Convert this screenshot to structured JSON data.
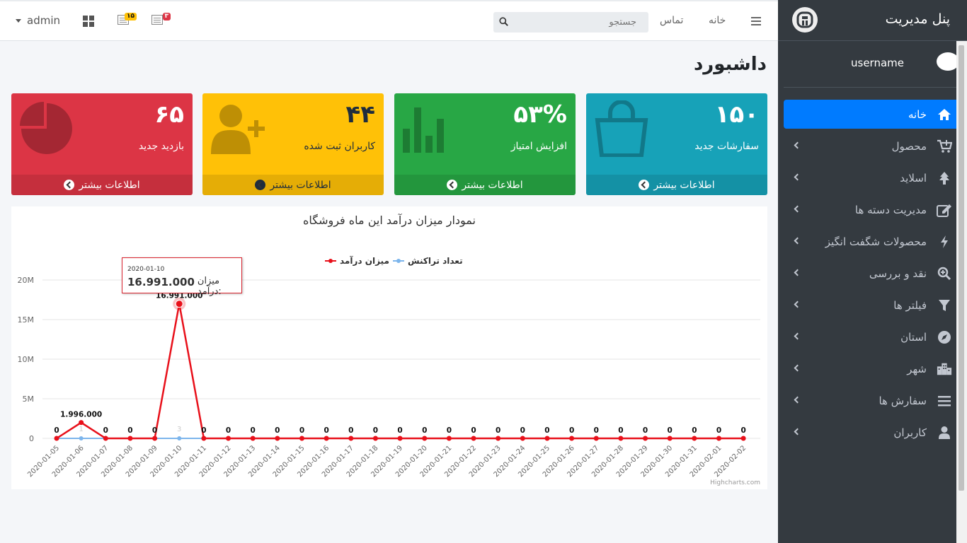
{
  "navbar": {
    "user": "admin",
    "badge_1": "۱۵",
    "badge_2": "۳",
    "search_placeholder": "جستجو",
    "links": [
      "تماس",
      "خانه"
    ]
  },
  "sidebar": {
    "title": "پنل مدیریت",
    "username": "username",
    "items": [
      {
        "label": "خانه",
        "icon": "home-icon"
      },
      {
        "label": "محصول",
        "icon": "cart-plus-icon"
      },
      {
        "label": "اسلاید",
        "icon": "tree-icon"
      },
      {
        "label": "مدیریت دسته ها",
        "icon": "edit-icon"
      },
      {
        "label": "محصولات شگفت انگیز",
        "icon": "bolt-icon"
      },
      {
        "label": "نقد و بررسی",
        "icon": "search-plus-icon"
      },
      {
        "label": "فیلتر ها",
        "icon": "filter-icon"
      },
      {
        "label": "استان",
        "icon": "compass-icon"
      },
      {
        "label": "شهر",
        "icon": "city-icon"
      },
      {
        "label": "سفارش ها",
        "icon": "list-icon"
      },
      {
        "label": "کاربران",
        "icon": "user-icon"
      }
    ]
  },
  "page": {
    "title": "داشبورد"
  },
  "boxes": [
    {
      "value": "۶۵",
      "text": "بازدید جدید",
      "footer": "اطلاعات بیشتر",
      "color": "#dc3545",
      "icon": "pie-chart-icon"
    },
    {
      "value": "۴۴",
      "text": "کاربران ثبت شده",
      "footer": "اطلاعات بیشتر",
      "color": "#ffc107",
      "icon": "user-plus-icon"
    },
    {
      "value": "۵۳%",
      "text": "افزایش امتیاز",
      "footer": "اطلاعات بیشتر",
      "color": "#28a745",
      "icon": "bar-chart-icon"
    },
    {
      "value": "۱۵۰",
      "text": "سفارشات جدید",
      "footer": "اطلاعات بیشتر",
      "color": "#17a2b8",
      "icon": "shopping-bag-icon"
    }
  ],
  "chart_data": {
    "type": "line",
    "title": "نمودار میزان درآمد این ماه فروشگاه",
    "categories": [
      "2020-01-05",
      "2020-01-06",
      "2020-01-07",
      "2020-01-08",
      "2020-01-09",
      "2020-01-10",
      "2020-01-11",
      "2020-01-12",
      "2020-01-13",
      "2020-01-14",
      "2020-01-15",
      "2020-01-16",
      "2020-01-17",
      "2020-01-18",
      "2020-01-19",
      "2020-01-20",
      "2020-01-21",
      "2020-01-22",
      "2020-01-23",
      "2020-01-24",
      "2020-01-25",
      "2020-01-26",
      "2020-01-27",
      "2020-01-28",
      "2020-01-29",
      "2020-01-30",
      "2020-01-31",
      "2020-02-01",
      "2020-02-02"
    ],
    "series": [
      {
        "name": "میزان درآمد",
        "color": "#e8101a",
        "values": [
          0,
          1996000,
          0,
          0,
          0,
          16991000,
          0,
          0,
          0,
          0,
          0,
          0,
          0,
          0,
          0,
          0,
          0,
          0,
          0,
          0,
          0,
          0,
          0,
          0,
          0,
          0,
          0,
          0,
          0
        ],
        "labels": [
          "0",
          "1.996.000",
          "0",
          "0",
          "0",
          "16.991.000",
          "0",
          "0",
          "0",
          "0",
          "0",
          "0",
          "0",
          "0",
          "0",
          "0",
          "0",
          "0",
          "0",
          "0",
          "0",
          "0",
          "0",
          "0",
          "0",
          "0",
          "0",
          "0",
          "0"
        ]
      },
      {
        "name": "تعداد تراکنش",
        "color": "#7cb5ec",
        "values": [
          0,
          1,
          0,
          0,
          0,
          3,
          0,
          0,
          0,
          0,
          0,
          0,
          0,
          0,
          0,
          0,
          0,
          0,
          0,
          0,
          0,
          0,
          0,
          0,
          0,
          0,
          0,
          0,
          0
        ]
      }
    ],
    "yticks": [
      "0",
      "5M",
      "10M",
      "15M",
      "20M"
    ],
    "ylim": [
      0,
      20000000
    ],
    "legend_position": "top-center",
    "tooltip": {
      "date": "2020-01-10",
      "label": "میزان درآمد:",
      "value": "16.991.000"
    },
    "credits": "Highcharts.com"
  }
}
